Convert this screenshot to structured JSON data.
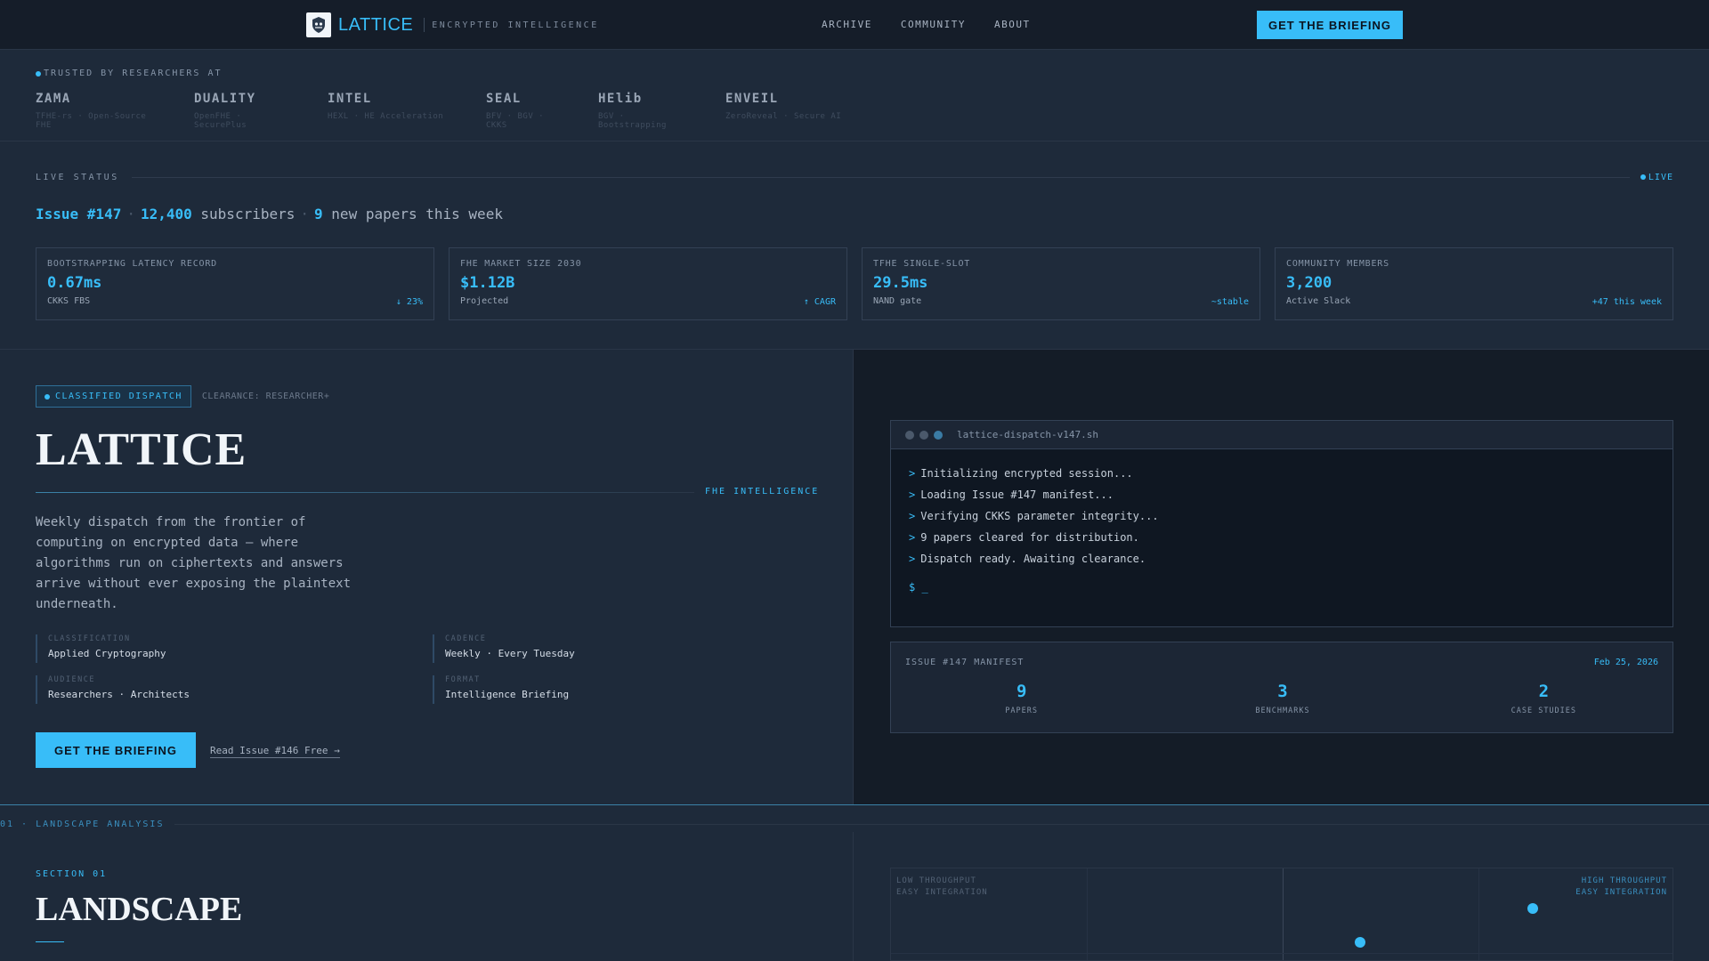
{
  "nav": {
    "brand": "LATTICE",
    "tagline": "ENCRYPTED INTELLIGENCE",
    "links": [
      "ARCHIVE",
      "COMMUNITY",
      "ABOUT"
    ],
    "cta": "GET THE BRIEFING"
  },
  "trusted": {
    "label": "TRUSTED BY RESEARCHERS AT",
    "logos": [
      {
        "name": "ZAMA",
        "sub": "TFHE-rs · Open-Source FHE"
      },
      {
        "name": "DUALITY",
        "sub": "OpenFHE · SecurePlus"
      },
      {
        "name": "INTEL",
        "sub": "HEXL · HE Acceleration"
      },
      {
        "name": "SEAL",
        "sub": "BFV · BGV · CKKS"
      },
      {
        "name": "HElib",
        "sub": "BGV · Bootstrapping"
      },
      {
        "name": "ENVEIL",
        "sub": "ZeroReveal · Secure AI"
      }
    ]
  },
  "status": {
    "label": "LIVE STATUS",
    "live": "LIVE",
    "issue": "Issue #147",
    "subscribers_count": "12,400",
    "subscribers_word": "subscribers",
    "papers_count": "9",
    "papers_text": "new papers this week",
    "separator": "·"
  },
  "metrics": [
    {
      "label": "BOOTSTRAPPING LATENCY RECORD",
      "value": "0.67ms",
      "sub": "CKKS FBS",
      "delta": "↓ 23%"
    },
    {
      "label": "FHE MARKET SIZE 2030",
      "value": "$1.12B",
      "sub": "Projected",
      "delta": "↑ CAGR"
    },
    {
      "label": "TFHE SINGLE-SLOT",
      "value": "29.5ms",
      "sub": "NAND gate",
      "delta": "~stable"
    },
    {
      "label": "COMMUNITY MEMBERS",
      "value": "3,200",
      "sub": "Active Slack",
      "delta": "+47 this week"
    }
  ],
  "hero": {
    "badge": "CLASSIFIED DISPATCH",
    "clearance": "CLEARANCE: RESEARCHER+",
    "title": "LATTICE",
    "rule_tag": "FHE INTELLIGENCE",
    "description": "Weekly dispatch from the frontier of computing on encrypted data — where algorithms run on ciphertexts and answers arrive without ever exposing the plaintext underneath.",
    "specs": [
      {
        "k": "CLASSIFICATION",
        "v": "Applied Cryptography"
      },
      {
        "k": "CADENCE",
        "v": "Weekly · Every Tuesday"
      },
      {
        "k": "AUDIENCE",
        "v": "Researchers · Architects"
      },
      {
        "k": "FORMAT",
        "v": "Intelligence Briefing"
      }
    ],
    "cta": "GET THE BRIEFING",
    "link": "Read Issue #146 Free →"
  },
  "terminal": {
    "file": "lattice-dispatch-v147.sh",
    "prompt_char": ">",
    "lines": [
      "Initializing encrypted session...",
      "Loading Issue #147 manifest...",
      "Verifying CKKS parameter integrity...",
      "9 papers cleared for distribution.",
      "Dispatch ready. Awaiting clearance."
    ],
    "prompt": "$ _"
  },
  "manifest": {
    "title": "ISSUE #147 MANIFEST",
    "date": "Feb 25, 2026",
    "stats": [
      {
        "num": "9",
        "label": "PAPERS"
      },
      {
        "num": "3",
        "label": "BENCHMARKS"
      },
      {
        "num": "2",
        "label": "CASE STUDIES"
      }
    ]
  },
  "landscape": {
    "strip": "01 · LANDSCAPE ANALYSIS",
    "section": "SECTION 01",
    "title": "LANDSCAPE",
    "quad_tl": [
      "LOW THROUGHPUT",
      "EASY INTEGRATION"
    ],
    "quad_tr": [
      "HIGH THROUGHPUT",
      "EASY INTEGRATION"
    ]
  },
  "colors": {
    "accent": "#38bdf8",
    "background": "#1e2a3a",
    "nav_bg": "#151d29"
  }
}
